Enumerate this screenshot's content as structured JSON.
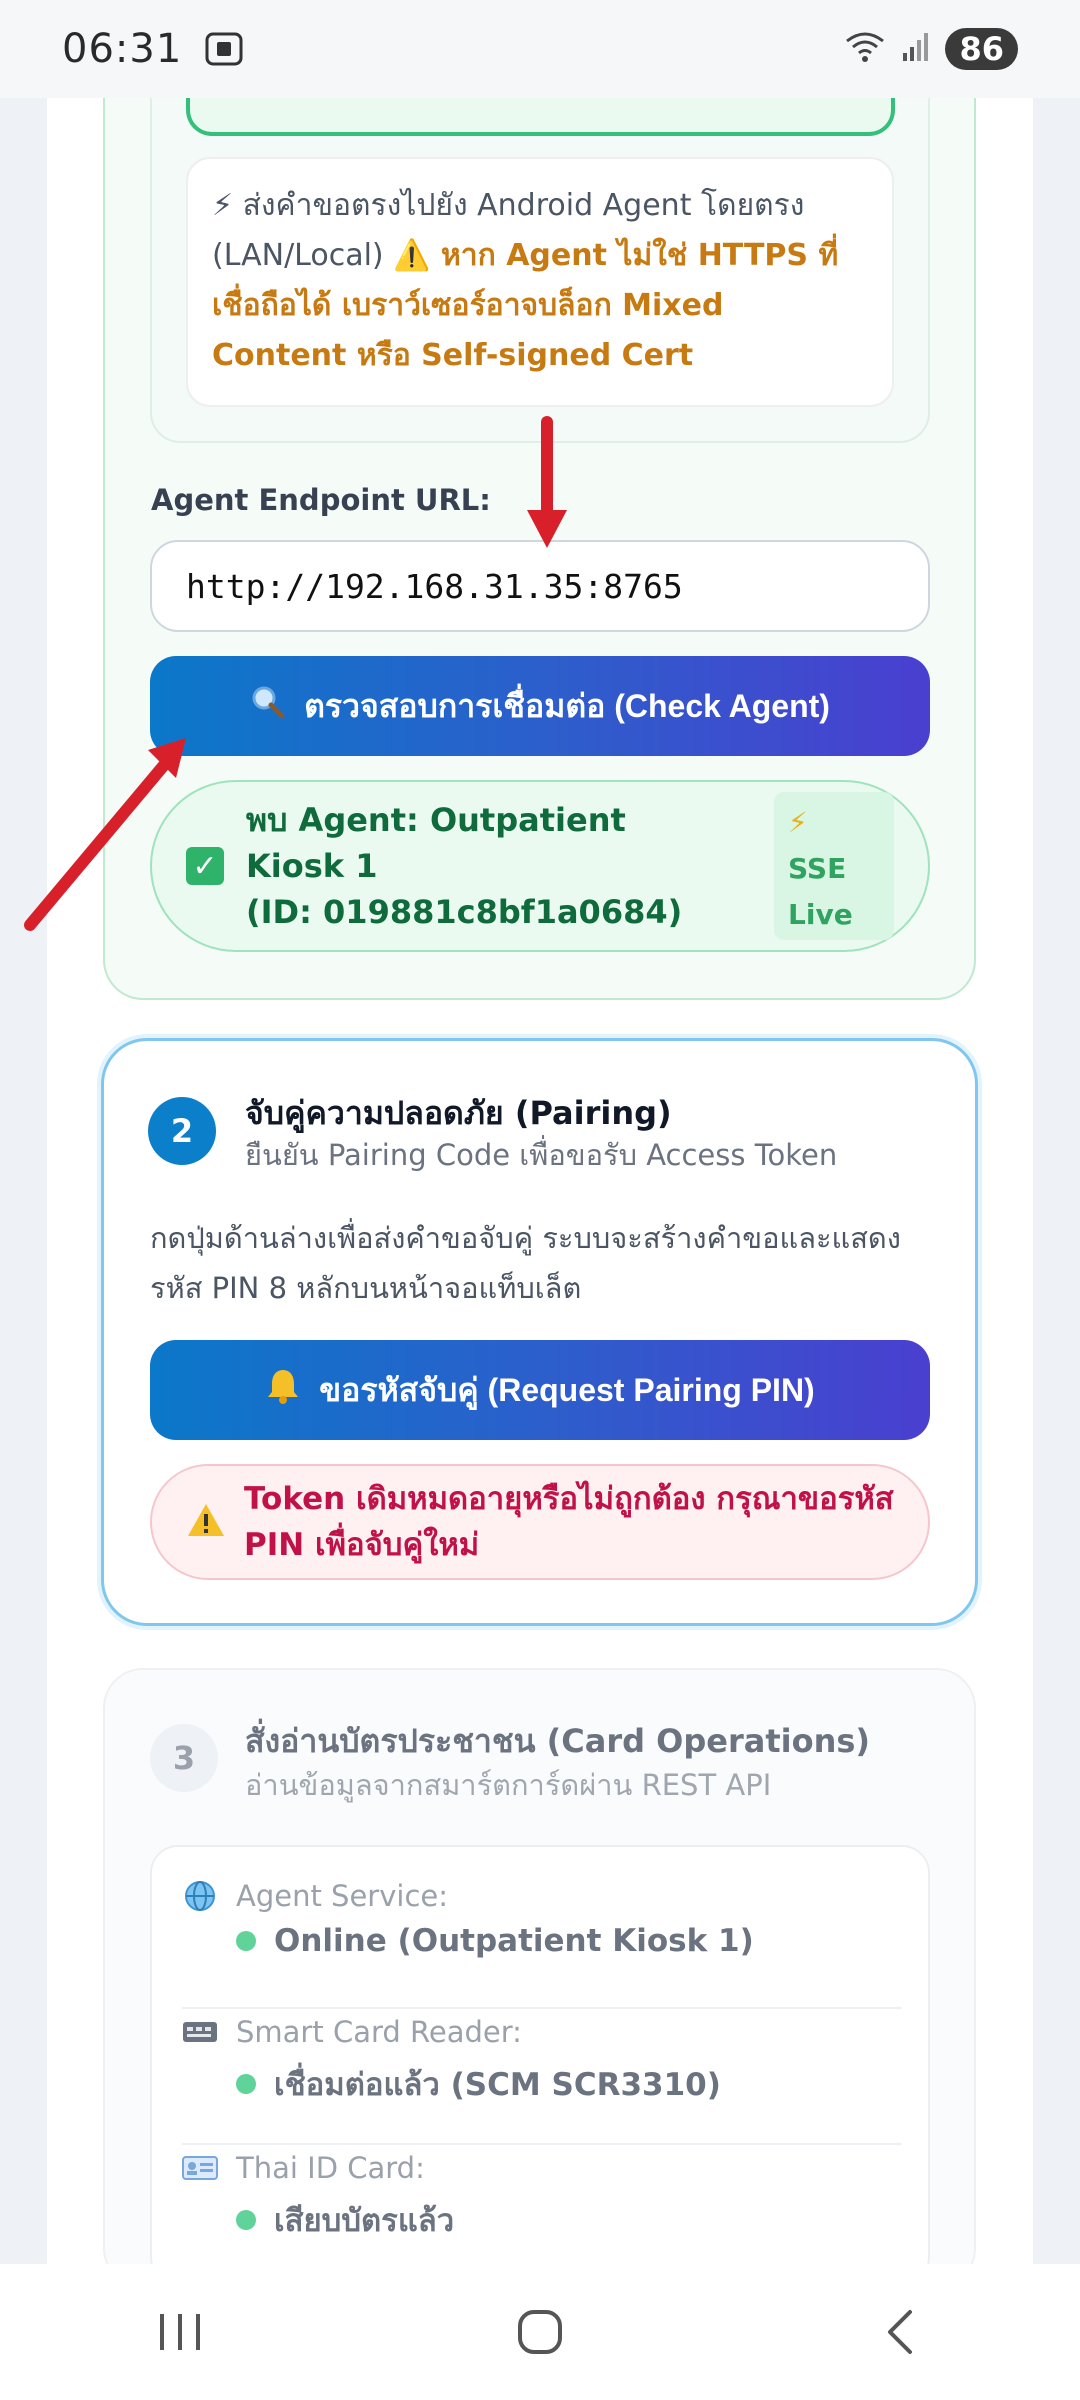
{
  "status_bar": {
    "time": "06:31",
    "battery": "86"
  },
  "card1": {
    "info_normal": "⚡ ส่งคำขอตรงไปยัง Android Agent โดยตรง (LAN/Local) ",
    "info_warn": "⚠️ หาก Agent ไม่ใช่ HTTPS ที่เชื่อถือได้ เบราว์เซอร์อาจบล็อก Mixed Content หรือ Self-signed Cert",
    "endpoint_label": "Agent Endpoint URL:",
    "endpoint_value": "http://192.168.31.35:8765",
    "check_button": "ตรวจสอบการเชื่อมต่อ (Check Agent)",
    "agent_found_line1": "พบ Agent: Outpatient Kiosk 1",
    "agent_found_line2": "(ID: 019881c8bf1a0684)",
    "sse_bolt": "⚡",
    "sse_line1": "SSE",
    "sse_line2": "Live"
  },
  "card2": {
    "step": "2",
    "title": "จับคู่ความปลอดภัย (Pairing)",
    "subtitle": "ยืนยัน Pairing Code เพื่อขอรับ Access Token",
    "description": "กดปุ่มด้านล่างเพื่อส่งคำขอจับคู่ ระบบจะสร้างคำขอและแสดงรหัส PIN 8 หลักบนหน้าจอแท็บเล็ต",
    "pairing_button": "ขอรหัสจับคู่ (Request Pairing PIN)",
    "alert_text": "Token เดิมหมดอายุหรือไม่ถูกต้อง กรุณาขอรหัส PIN เพื่อจับคู่ใหม่"
  },
  "card3": {
    "step": "3",
    "title": "สั่งอ่านบัตรประชาชน (Card Operations)",
    "subtitle": "อ่านข้อมูลจากสมาร์ตการ์ดผ่าน REST API",
    "rows": [
      {
        "label": "Agent Service:",
        "value": "Online (Outpatient Kiosk 1)",
        "icon": "globe-icon"
      },
      {
        "label": "Smart Card Reader:",
        "value": "เชื่อมต่อแล้ว (SCM SCR3310)",
        "icon": "card-reader-icon"
      },
      {
        "label": "Thai ID Card:",
        "value": "เสียบบัตรแล้ว",
        "icon": "id-card-icon"
      }
    ]
  },
  "colors": {
    "accent_blue": "#0b78c9",
    "accent_indigo": "#4a3fd0",
    "success_green": "#2fb36b",
    "warning_orange": "#c77a12",
    "error_red": "#c01246",
    "annotation_red": "#d8202a"
  }
}
